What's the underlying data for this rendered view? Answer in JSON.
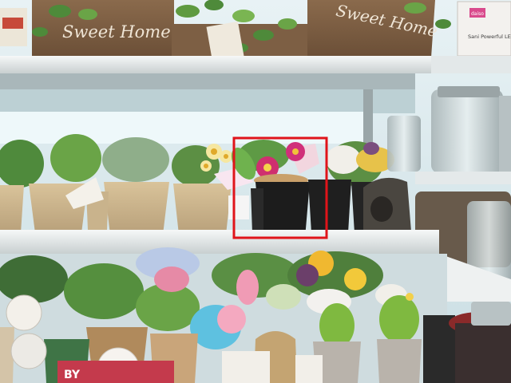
{
  "scene": {
    "sign_left_text": "Sweet Home",
    "sign_right_text": "Sweet Home",
    "box_brand": "daiso",
    "box_label": "Sani Powerful LED",
    "price_tag_text": "BY",
    "highlight_color": "#e0141a"
  }
}
